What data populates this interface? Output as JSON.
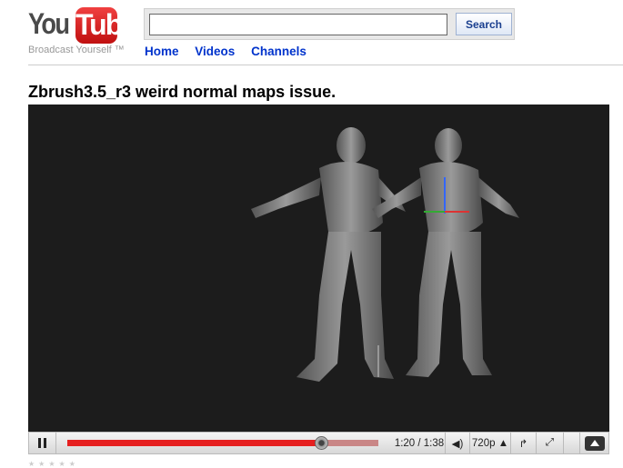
{
  "logo": {
    "you": "You",
    "tube": "Tube",
    "tagline": "Broadcast Yourself ™"
  },
  "search": {
    "value": "",
    "button": "Search"
  },
  "nav": [
    "Home",
    "Videos",
    "Channels"
  ],
  "title": "Zbrush3.5_r3 weird normal maps issue.",
  "player": {
    "progress_fraction": 0.816,
    "time": "1:20 / 1:38",
    "quality": "720p",
    "state": "playing"
  },
  "rating": {
    "stars": "★★★★★"
  }
}
